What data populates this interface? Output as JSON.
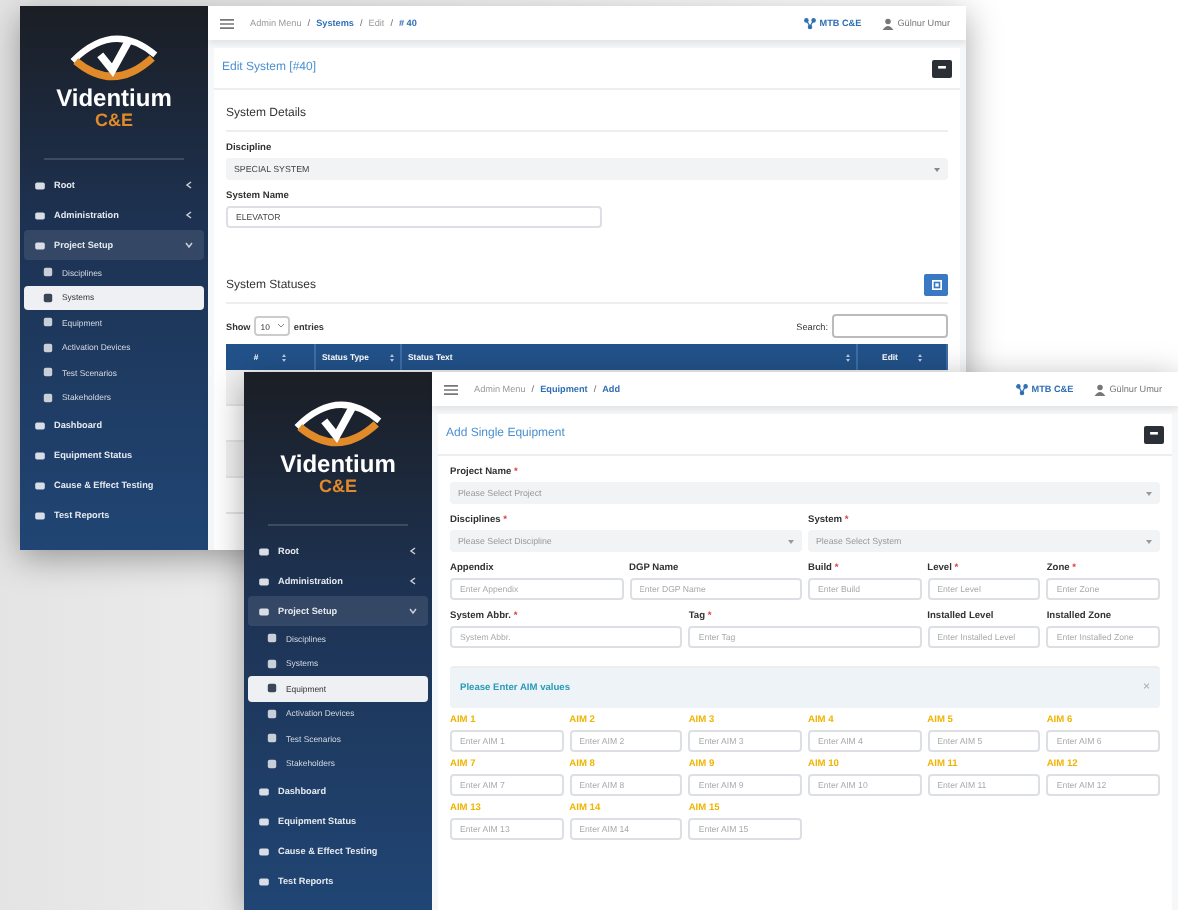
{
  "windows": [
    {
      "kind": "edit_system",
      "sidebar": {
        "brand": "Videntium",
        "brand_sub": "C&E",
        "items": [
          {
            "label": "Root",
            "kind": "group",
            "expanded": false
          },
          {
            "label": "Administration",
            "kind": "group",
            "expanded": false
          },
          {
            "label": "Project Setup",
            "kind": "group",
            "expanded": true,
            "children": [
              {
                "label": "Disciplines",
                "selected": false
              },
              {
                "label": "Systems",
                "selected": true
              },
              {
                "label": "Equipment",
                "selected": false
              },
              {
                "label": "Activation Devices",
                "selected": false
              },
              {
                "label": "Test Scenarios",
                "selected": false
              },
              {
                "label": "Stakeholders",
                "selected": false
              }
            ]
          },
          {
            "label": "Dashboard",
            "kind": "link"
          },
          {
            "label": "Equipment Status",
            "kind": "link"
          },
          {
            "label": "Cause & Effect Testing",
            "kind": "link"
          },
          {
            "label": "Test Reports",
            "kind": "link"
          }
        ]
      },
      "header": {
        "breadcrumb": [
          {
            "text": "Admin Menu",
            "link": false
          },
          {
            "text": "Systems",
            "link": true
          },
          {
            "text": "Edit",
            "link": false
          },
          {
            "text": "# 40",
            "link": true
          }
        ],
        "separator": "/",
        "brand": "MTB C&E",
        "user": "Gülnur Umur"
      },
      "content": {
        "title": "Edit System [#40]",
        "section": "System Details",
        "fields": [
          {
            "label": "Discipline",
            "kind": "select",
            "value": "SPECIAL SYSTEM"
          },
          {
            "label": "System Name",
            "kind": "input",
            "value": "ELEVATOR"
          }
        ],
        "statuses": {
          "title": "System Statuses",
          "show": "Show",
          "page_size": "10",
          "entries": "entries",
          "search_label": "Search:",
          "columns": [
            "#",
            "Status Type",
            "Status Text",
            "Edit"
          ]
        }
      }
    },
    {
      "kind": "add_equipment",
      "sidebar": {
        "brand": "Videntium",
        "brand_sub": "C&E",
        "items": [
          {
            "label": "Root",
            "kind": "group",
            "expanded": false
          },
          {
            "label": "Administration",
            "kind": "group",
            "expanded": false
          },
          {
            "label": "Project Setup",
            "kind": "group",
            "expanded": true,
            "children": [
              {
                "label": "Disciplines",
                "selected": false
              },
              {
                "label": "Systems",
                "selected": false
              },
              {
                "label": "Equipment",
                "selected": true
              },
              {
                "label": "Activation Devices",
                "selected": false
              },
              {
                "label": "Test Scenarios",
                "selected": false
              },
              {
                "label": "Stakeholders",
                "selected": false
              }
            ]
          },
          {
            "label": "Dashboard",
            "kind": "link"
          },
          {
            "label": "Equipment Status",
            "kind": "link"
          },
          {
            "label": "Cause & Effect Testing",
            "kind": "link"
          },
          {
            "label": "Test Reports",
            "kind": "link"
          }
        ]
      },
      "header": {
        "breadcrumb": [
          {
            "text": "Admin Menu",
            "link": false
          },
          {
            "text": "Equipment",
            "link": true
          },
          {
            "text": "Add",
            "link": true
          }
        ],
        "separator": "/",
        "brand": "MTB C&E",
        "user": "Gülnur Umur"
      },
      "content": {
        "title": "Add Single Equipment",
        "required_mark": "*",
        "fields": [
          {
            "label": "Project Name",
            "required": true,
            "kind": "select",
            "placeholder": "Please Select Project"
          },
          {
            "label": "Disciplines",
            "required": true,
            "kind": "select",
            "placeholder": "Please Select Discipline"
          },
          {
            "label": "System",
            "required": true,
            "kind": "select",
            "placeholder": "Please Select System"
          },
          {
            "label": "Appendix",
            "required": false,
            "kind": "input",
            "placeholder": "Enter Appendix"
          },
          {
            "label": "DGP Name",
            "required": false,
            "kind": "input",
            "placeholder": "Enter DGP Name"
          },
          {
            "label": "Build",
            "required": true,
            "kind": "input",
            "placeholder": "Enter Build"
          },
          {
            "label": "Level",
            "required": true,
            "kind": "input",
            "placeholder": "Enter Level"
          },
          {
            "label": "Zone",
            "required": true,
            "kind": "input",
            "placeholder": "Enter Zone"
          },
          {
            "label": "System Abbr.",
            "required": true,
            "kind": "input",
            "placeholder": "System Abbr."
          },
          {
            "label": "Tag",
            "required": true,
            "kind": "input",
            "placeholder": "Enter Tag"
          },
          {
            "label": "Installed Level",
            "required": false,
            "kind": "input",
            "placeholder": "Enter Installed Level"
          },
          {
            "label": "Installed Zone",
            "required": false,
            "kind": "input",
            "placeholder": "Enter Installed Zone"
          }
        ],
        "alert": {
          "text": "Please Enter AIM values",
          "close": "×"
        },
        "aims": [
          {
            "label": "AIM 1",
            "placeholder": "Enter AIM 1"
          },
          {
            "label": "AIM 2",
            "placeholder": "Enter AIM 2"
          },
          {
            "label": "AIM 3",
            "placeholder": "Enter AIM 3"
          },
          {
            "label": "AIM 4",
            "placeholder": "Enter AIM 4"
          },
          {
            "label": "AIM 5",
            "placeholder": "Enter AIM 5"
          },
          {
            "label": "AIM 6",
            "placeholder": "Enter AIM 6"
          },
          {
            "label": "AIM 7",
            "placeholder": "Enter AIM 7"
          },
          {
            "label": "AIM 8",
            "placeholder": "Enter AIM 8"
          },
          {
            "label": "AIM 9",
            "placeholder": "Enter AIM 9"
          },
          {
            "label": "AIM 10",
            "placeholder": "Enter AIM 10"
          },
          {
            "label": "AIM 11",
            "placeholder": "Enter AIM 11"
          },
          {
            "label": "AIM 12",
            "placeholder": "Enter AIM 12"
          },
          {
            "label": "AIM 13",
            "placeholder": "Enter AIM 13"
          },
          {
            "label": "AIM 14",
            "placeholder": "Enter AIM 14"
          },
          {
            "label": "AIM 15",
            "placeholder": "Enter AIM 15"
          }
        ]
      }
    }
  ]
}
